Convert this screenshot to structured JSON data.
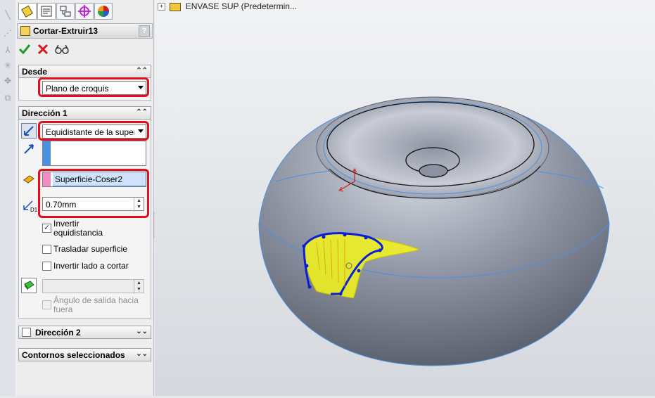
{
  "tree": {
    "expand": "+",
    "root_label": "ENVASE SUP  (Predetermin..."
  },
  "feature": {
    "title": "Cortar-Extruir13",
    "help": "?"
  },
  "actions": {
    "ok_icon": "check-icon",
    "cancel_icon": "x-icon",
    "preview_icon": "glasses-icon"
  },
  "desde": {
    "header": "Desde",
    "dropdown_value": "Plano de croquis"
  },
  "direccion1": {
    "header": "Dirección 1",
    "end_condition": "Equidistante de la super",
    "face_value": "Superficie-Coser2",
    "offset_value": "0.70mm",
    "invert_offset_line1": "Invertir",
    "invert_offset_line2": "equidistancia",
    "translate_surface": "Trasladar superficie",
    "flip_side": "Invertir lado a cortar",
    "draft_line1": "Ángulo de salida hacia",
    "draft_line2": "fuera",
    "d1_label": "D1"
  },
  "direccion2": {
    "header": "Dirección 2"
  },
  "contornos": {
    "header": "Contornos seleccionados"
  },
  "colors": {
    "highlight": "#e2101e",
    "selection_blue": "#4a90e2",
    "face_pink": "#f28bc2",
    "sketch_blue": "#0a1fd6",
    "cut_yellow": "#f5f51a"
  }
}
